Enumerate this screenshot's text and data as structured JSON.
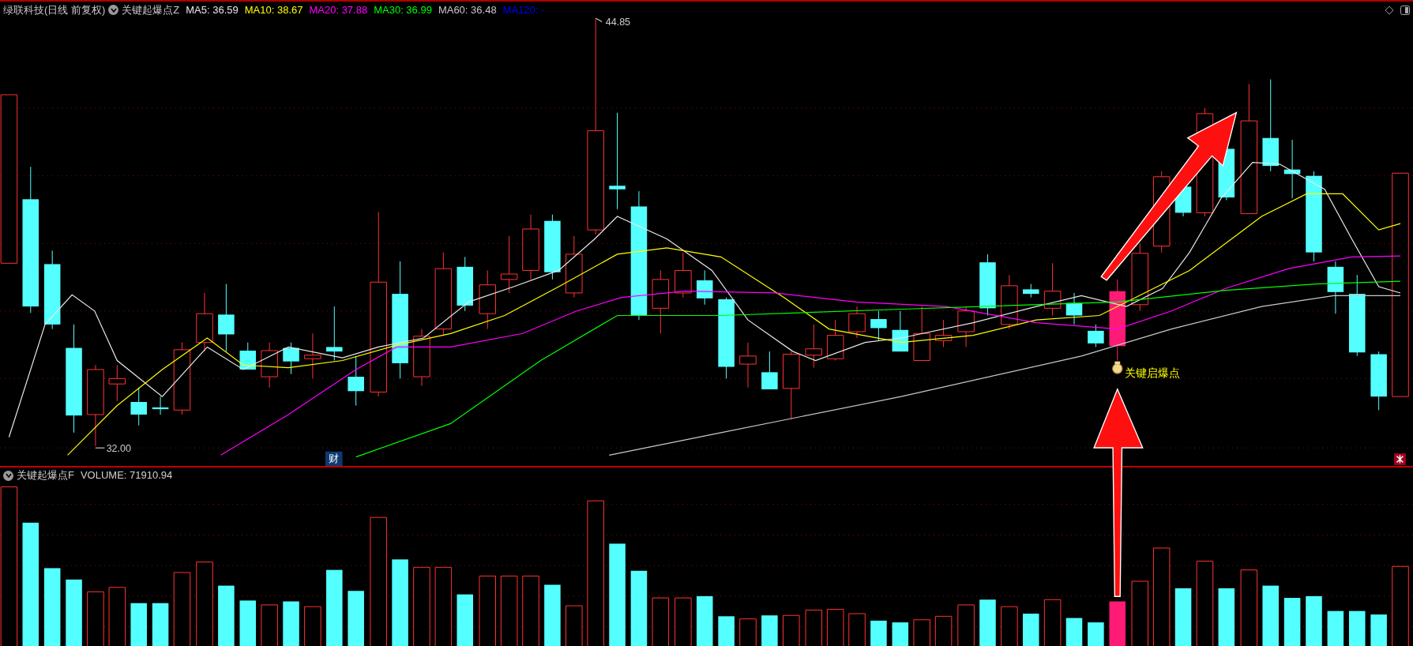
{
  "header": {
    "stock": "绿联科技(日线 前复权)",
    "indicator": "关键起爆点Z",
    "ma_readings": [
      {
        "label": "MA5: 36.59",
        "color": "#e8e8e8"
      },
      {
        "label": "MA10: 38.67",
        "color": "#ffff00"
      },
      {
        "label": "MA20: 37.88",
        "color": "#ff00ff"
      },
      {
        "label": "MA30: 36.99",
        "color": "#00ff00"
      },
      {
        "label": "MA60: 36.48",
        "color": "#c8c8c8"
      },
      {
        "label": "MA120: -",
        "color": "#0000ff"
      }
    ]
  },
  "main_chart": {
    "high_label": "44.85",
    "low_label": "32.00",
    "finance_badge": "财",
    "signal_label": "关键启爆点"
  },
  "volume_panel": {
    "indicator": "关键起爆点F",
    "reading": "VOLUME: 71910.94"
  }
}
